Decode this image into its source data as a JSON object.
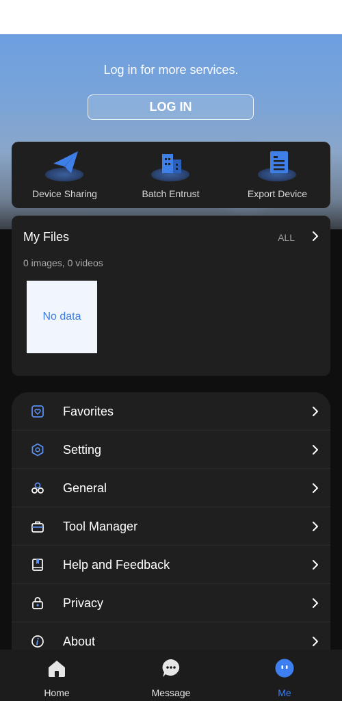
{
  "hero": {
    "prompt": "Log in for more services.",
    "login_label": "LOG IN"
  },
  "quick_actions": [
    {
      "label": "Device Sharing",
      "icon": "paper-plane-icon"
    },
    {
      "label": "Batch Entrust",
      "icon": "buildings-icon"
    },
    {
      "label": "Export Device",
      "icon": "document-icon"
    }
  ],
  "files": {
    "title": "My Files",
    "all_label": "ALL",
    "summary": "0 images, 0 videos",
    "empty_label": "No data"
  },
  "menu": [
    {
      "label": "Favorites",
      "icon": "heart-box-icon"
    },
    {
      "label": "Setting",
      "icon": "hexagon-gear-icon"
    },
    {
      "label": "General",
      "icon": "three-circles-icon"
    },
    {
      "label": "Tool Manager",
      "icon": "toolbox-icon"
    },
    {
      "label": "Help and Feedback",
      "icon": "book-icon"
    },
    {
      "label": "Privacy",
      "icon": "lock-icon"
    },
    {
      "label": "About",
      "icon": "info-icon"
    }
  ],
  "tabs": [
    {
      "label": "Home",
      "icon": "home-icon",
      "active": false
    },
    {
      "label": "Message",
      "icon": "chat-bubble-icon",
      "active": false
    },
    {
      "label": "Me",
      "icon": "face-icon",
      "active": true
    }
  ],
  "colors": {
    "accent": "#3d7ff0",
    "card": "#1f1f1f",
    "background": "#0f0f0f"
  }
}
